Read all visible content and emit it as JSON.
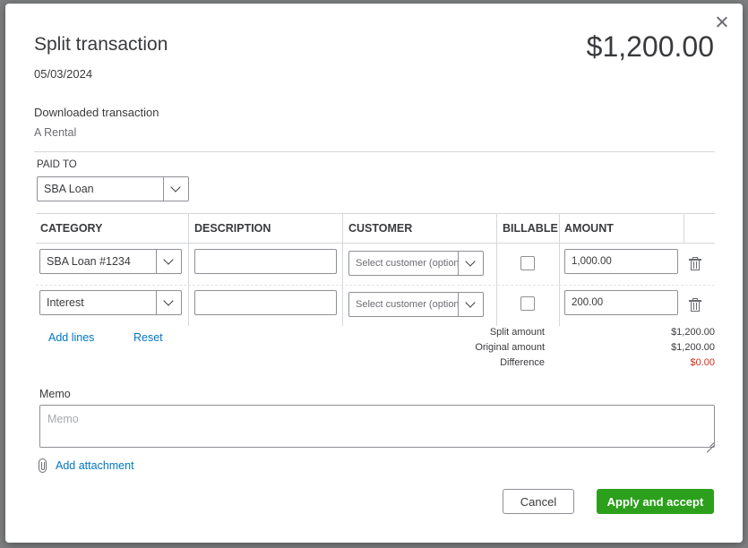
{
  "header": {
    "title": "Split transaction",
    "date": "05/03/2024",
    "total": "$1,200.00"
  },
  "downloaded": {
    "label": "Downloaded transaction",
    "value": "A Rental"
  },
  "paid_to": {
    "label": "PAID TO",
    "value": "SBA Loan"
  },
  "columns": {
    "category": "CATEGORY",
    "description": "DESCRIPTION",
    "customer": "CUSTOMER",
    "billable": "BILLABLE",
    "amount": "AMOUNT"
  },
  "rows": [
    {
      "category": "SBA Loan #1234",
      "description": "",
      "customer_placeholder": "Select customer (optional)",
      "billable": false,
      "amount": "1,000.00"
    },
    {
      "category": "Interest",
      "description": "",
      "customer_placeholder": "Select customer (optional)",
      "billable": false,
      "amount": "200.00"
    }
  ],
  "actions": {
    "add_lines": "Add lines",
    "reset": "Reset"
  },
  "summary": {
    "split_label": "Split amount",
    "split_value": "$1,200.00",
    "original_label": "Original amount",
    "original_value": "$1,200.00",
    "difference_label": "Difference",
    "difference_value": "$0.00",
    "difference_color": "#d52b1e"
  },
  "memo": {
    "label": "Memo",
    "placeholder": "Memo"
  },
  "attachment": {
    "label": "Add attachment"
  },
  "footer": {
    "cancel": "Cancel",
    "apply": "Apply and accept"
  },
  "colors": {
    "accent": "#2ca01c",
    "link": "#0077c5"
  }
}
